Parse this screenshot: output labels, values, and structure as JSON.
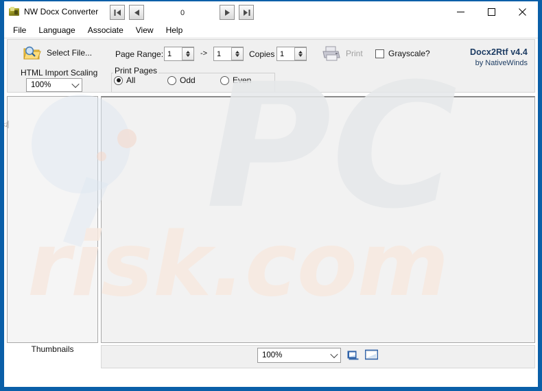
{
  "window": {
    "title": "NW Docx Converter",
    "icon": "app-icon",
    "controls": {
      "minimize": "minimize-icon",
      "maximize": "maximize-icon",
      "close": "close-icon"
    }
  },
  "menubar": {
    "items": [
      {
        "label": "File"
      },
      {
        "label": "Language"
      },
      {
        "label": "Associate"
      },
      {
        "label": "View"
      },
      {
        "label": "Help"
      }
    ]
  },
  "toolbar": {
    "select_file_label": "Select File...",
    "select_file_icon": "folder-search-icon",
    "page_range_label": "Page Range:",
    "page_range_from": "1",
    "page_range_to": "1",
    "range_arrow": "->",
    "copies_label": "Copies",
    "copies_value": "1",
    "print_label": "Print",
    "print_icon": "printer-icon",
    "print_enabled": false,
    "grayscale_label": "Grayscale?",
    "grayscale_checked": false,
    "scaling_label": "HTML Import Scaling",
    "scaling_value": "100%",
    "print_pages_title": "Print Pages",
    "print_pages_options": [
      {
        "label": "All",
        "selected": true
      },
      {
        "label": "Odd",
        "selected": false
      },
      {
        "label": "Even",
        "selected": false
      }
    ]
  },
  "brand": {
    "product": "Docx2Rtf v4.4",
    "vendor": "by NativeWinds",
    "color": "#1d3c63"
  },
  "thumbnails": {
    "label": "Thumbnails",
    "splitter": "splitter-handle"
  },
  "statusbar": {
    "first_page_icon": "first-page-icon",
    "prev_page_icon": "previous-page-icon",
    "next_page_icon": "next-page-icon",
    "last_page_icon": "last-page-icon",
    "page_number": "0",
    "zoom_value": "100%",
    "view_single_icon": "page-view-icon",
    "view_fit_icon": "fit-page-icon"
  },
  "watermark": {
    "text_primary": "PC",
    "text_secondary": "risk.com",
    "color_primary": "#e6e8ea",
    "color_secondary": "#f7e9e0"
  }
}
